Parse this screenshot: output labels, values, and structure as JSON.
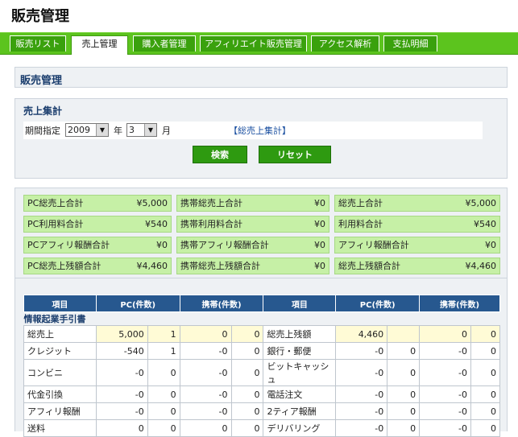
{
  "page": {
    "title": "販売管理"
  },
  "tabs": [
    {
      "label": "販売リスト",
      "active": false
    },
    {
      "label": "売上管理",
      "active": true
    },
    {
      "label": "購入者管理",
      "active": false
    },
    {
      "label": "アフィリエイト販売管理",
      "active": false
    },
    {
      "label": "アクセス解析",
      "active": false
    },
    {
      "label": "支払明細",
      "active": false
    }
  ],
  "section": {
    "title": "販売管理"
  },
  "search": {
    "title": "売上集計",
    "period_label": "期間指定",
    "year_value": "2009",
    "year_unit": "年",
    "month_value": "3",
    "month_unit": "月",
    "summary_link": "【総売上集計】",
    "search_button": "検索",
    "reset_button": "リセット"
  },
  "totals": {
    "rows": [
      [
        {
          "label": "PC総売上合計",
          "value": "¥5,000"
        },
        {
          "label": "携帯総売上合計",
          "value": "¥0"
        },
        {
          "label": "総売上合計",
          "value": "¥5,000"
        }
      ],
      [
        {
          "label": "PC利用料合計",
          "value": "¥540"
        },
        {
          "label": "携帯利用料合計",
          "value": "¥0"
        },
        {
          "label": "利用料合計",
          "value": "¥540"
        }
      ],
      [
        {
          "label": "PCアフィリ報酬合計",
          "value": "¥0"
        },
        {
          "label": "携帯アフィリ報酬合計",
          "value": "¥0"
        },
        {
          "label": "アフィリ報酬合計",
          "value": "¥0"
        }
      ],
      [
        {
          "label": "PC総売上残額合計",
          "value": "¥4,460"
        },
        {
          "label": "携帯総売上残額合計",
          "value": "¥0"
        },
        {
          "label": "総売上残額合計",
          "value": "¥4,460"
        }
      ]
    ]
  },
  "detail": {
    "headers": [
      "項目",
      "PC(件数)",
      "携帯(件数)",
      "項目",
      "PC(件数)",
      "携帯(件数)"
    ],
    "group_label": "情報起業手引書",
    "rows": [
      {
        "l_item": "総売上",
        "l_pc": "5,000",
        "l_pcc": "1",
        "l_mb": "0",
        "l_mbc": "0",
        "r_item": "総売上残額",
        "r_pc": "4,460",
        "r_pcc": "",
        "r_mb": "0",
        "r_mbc": "0",
        "hl": true
      },
      {
        "l_item": "クレジット",
        "l_pc": "-540",
        "l_pcc": "1",
        "l_mb": "-0",
        "l_mbc": "0",
        "r_item": "銀行・郵便",
        "r_pc": "-0",
        "r_pcc": "0",
        "r_mb": "-0",
        "r_mbc": "0",
        "hl": false
      },
      {
        "l_item": "コンビニ",
        "l_pc": "-0",
        "l_pcc": "0",
        "l_mb": "-0",
        "l_mbc": "0",
        "r_item": "ビットキャッシュ",
        "r_pc": "-0",
        "r_pcc": "0",
        "r_mb": "-0",
        "r_mbc": "0",
        "hl": false
      },
      {
        "l_item": "代金引換",
        "l_pc": "-0",
        "l_pcc": "0",
        "l_mb": "-0",
        "l_mbc": "0",
        "r_item": "電話注文",
        "r_pc": "-0",
        "r_pcc": "0",
        "r_mb": "-0",
        "r_mbc": "0",
        "hl": false
      },
      {
        "l_item": "アフィリ報酬",
        "l_pc": "-0",
        "l_pcc": "0",
        "l_mb": "-0",
        "l_mbc": "0",
        "r_item": "2ティア報酬",
        "r_pc": "-0",
        "r_pcc": "0",
        "r_mb": "-0",
        "r_mbc": "0",
        "hl": false
      },
      {
        "l_item": "送料",
        "l_pc": "0",
        "l_pcc": "0",
        "l_mb": "0",
        "l_mbc": "0",
        "r_item": "デリバリング",
        "r_pc": "-0",
        "r_pcc": "0",
        "r_mb": "-0",
        "r_mbc": "0",
        "hl": false
      }
    ]
  }
}
